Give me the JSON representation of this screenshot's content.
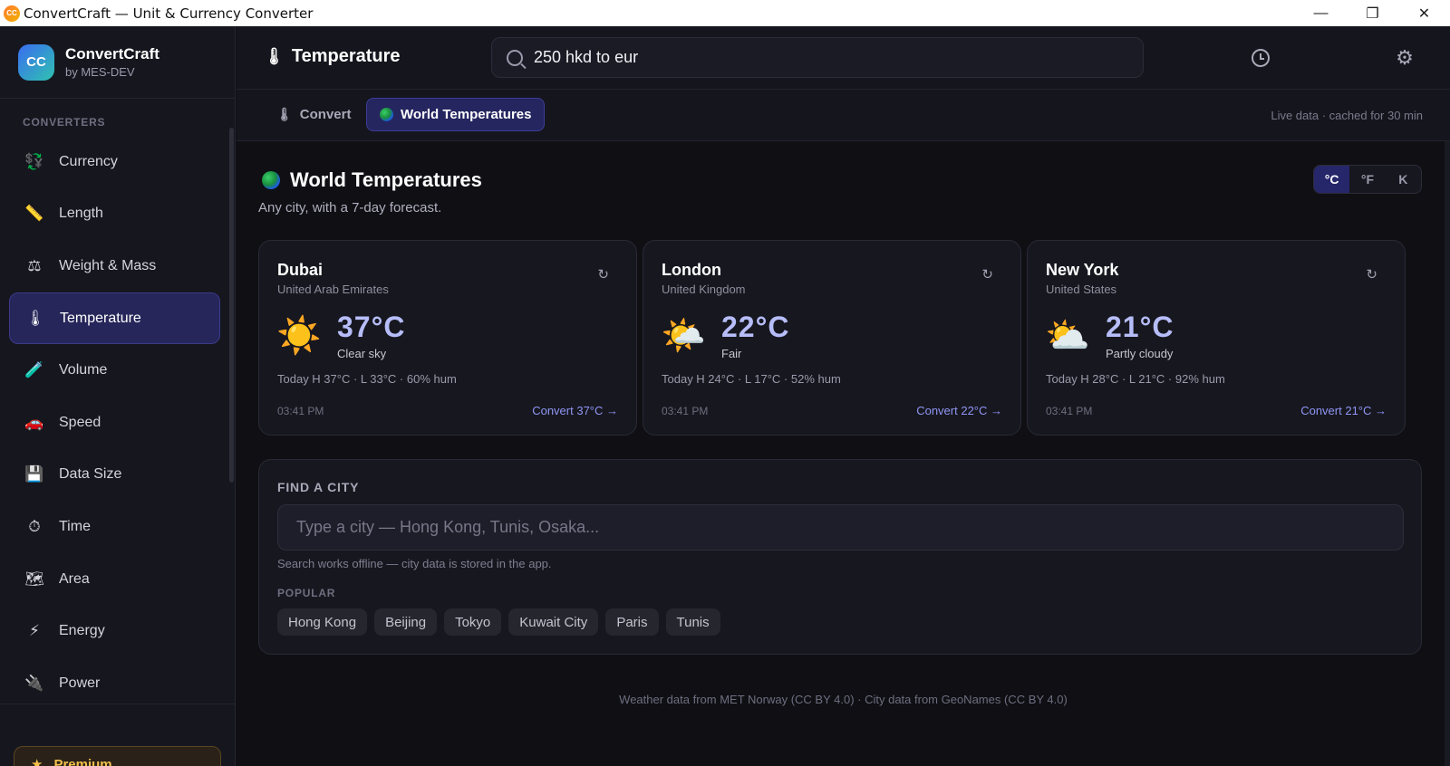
{
  "window": {
    "title": "ConvertCraft — Unit & Currency Converter",
    "app_icon_text": "CC",
    "minimize": "—",
    "maximize": "❐",
    "close": "✕"
  },
  "brand": {
    "logo": "CC",
    "name": "ConvertCraft",
    "by": "by MES-DEV"
  },
  "sidebar": {
    "section_label": "CONVERTERS",
    "items": [
      {
        "label": "Currency",
        "icon": "💱"
      },
      {
        "label": "Length",
        "icon": "📏"
      },
      {
        "label": "Weight & Mass",
        "icon": "⚖"
      },
      {
        "label": "Temperature",
        "icon": "🌡"
      },
      {
        "label": "Volume",
        "icon": "🧪"
      },
      {
        "label": "Speed",
        "icon": "🚗"
      },
      {
        "label": "Data Size",
        "icon": "💾"
      },
      {
        "label": "Time",
        "icon": "⏱"
      },
      {
        "label": "Area",
        "icon": "🗺"
      },
      {
        "label": "Energy",
        "icon": "⚡"
      },
      {
        "label": "Power",
        "icon": "🔌"
      }
    ],
    "active_index": 3,
    "premium": {
      "label": "Premium",
      "icon": "★"
    }
  },
  "header": {
    "title": "Temperature",
    "title_icon": "🌡",
    "search_value": "250 hkd to eur"
  },
  "tabs": {
    "convert": {
      "label": "Convert",
      "icon": "🌡"
    },
    "world": {
      "label": "World Temperatures"
    },
    "live_note": "Live data · cached for 30 min"
  },
  "main": {
    "title": "World Temperatures",
    "subtitle": "Any city, with a 7-day forecast.",
    "units": [
      "°C",
      "°F",
      "K"
    ],
    "active_unit": "°C",
    "cards": [
      {
        "city": "Dubai",
        "country": "United Arab Emirates",
        "temp": "37°C",
        "condition": "Clear sky",
        "icon": "☀️",
        "detail": "Today H 37°C · L 33°C · 60% hum",
        "time": "03:41 PM",
        "convert": "Convert 37°C →",
        "refresh": "↻"
      },
      {
        "city": "London",
        "country": "United Kingdom",
        "temp": "22°C",
        "condition": "Fair",
        "icon": "🌤️",
        "detail": "Today H 24°C · L 17°C · 52% hum",
        "time": "03:41 PM",
        "convert": "Convert 22°C →",
        "refresh": "↻"
      },
      {
        "city": "New York",
        "country": "United States",
        "temp": "21°C",
        "condition": "Partly cloudy",
        "icon": "⛅",
        "detail": "Today H 28°C · L 21°C · 92% hum",
        "time": "03:41 PM",
        "convert": "Convert 21°C →",
        "refresh": "↻"
      }
    ],
    "find": {
      "label": "FIND A CITY",
      "placeholder": "Type a city — Hong Kong, Tunis, Osaka...",
      "hint": "Search works offline — city data is stored in the app.",
      "popular_label": "POPULAR",
      "popular": [
        "Hong Kong",
        "Beijing",
        "Tokyo",
        "Kuwait City",
        "Paris",
        "Tunis"
      ]
    },
    "footer": "Weather data from MET Norway (CC BY 4.0) · City data from GeoNames (CC BY 4.0)"
  }
}
